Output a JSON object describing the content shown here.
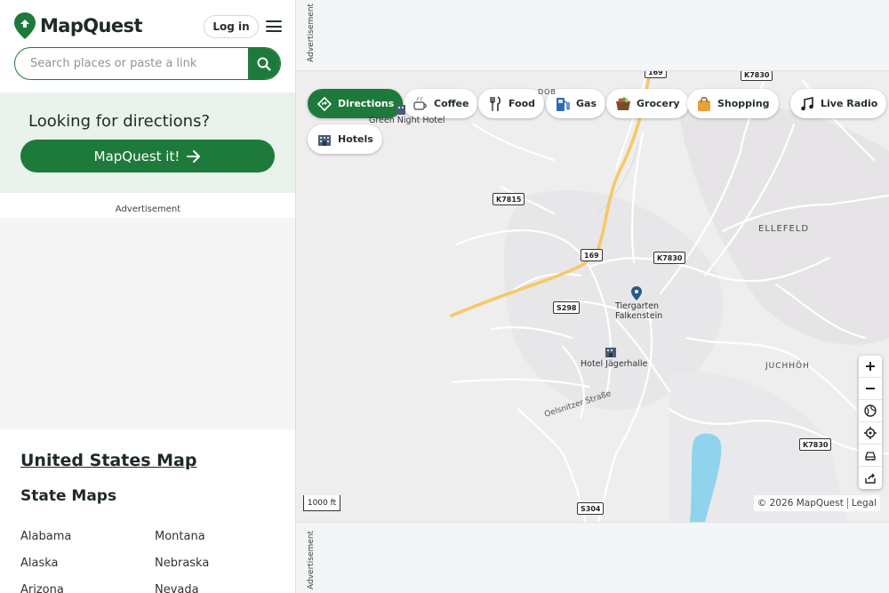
{
  "header": {
    "logo_text": "MapQuest",
    "login_label": "Log in",
    "search": {
      "placeholder": "Search places or paste a link",
      "value": ""
    }
  },
  "directions_card": {
    "title": "Looking for directions?",
    "button_label": "MapQuest it!"
  },
  "ad_label": "Advertisement",
  "us_map_link": "United States Map",
  "state_maps": {
    "title": "State Maps",
    "col1": [
      "Alabama",
      "Alaska",
      "Arizona"
    ],
    "col2": [
      "Montana",
      "Nebraska",
      "Nevada"
    ]
  },
  "map": {
    "chips": [
      {
        "label": "Directions",
        "icon": "directions-icon",
        "active": true
      },
      {
        "label": "Coffee",
        "icon": "coffee-icon"
      },
      {
        "label": "Food",
        "icon": "food-icon"
      },
      {
        "label": "Gas",
        "icon": "gas-icon"
      },
      {
        "label": "Grocery",
        "icon": "grocery-icon"
      },
      {
        "label": "Shopping",
        "icon": "shopping-icon"
      },
      {
        "label": "Live Radio",
        "icon": "radio-icon"
      },
      {
        "label": "Hotels",
        "icon": "hotel-icon"
      }
    ],
    "labels": {
      "green_night_hotel": "Green Night Hotel",
      "tiergarten_line1": "Tiergarten",
      "tiergarten_line2": "Falkenstein",
      "hotel_jagerhalle": "Hotel Jägerhalle",
      "ellefeld": "ELLEFELD",
      "juchhoh": "JUCHHÖH",
      "dob": "DOB",
      "oelsnitzer": "Oelsnitzer Straße"
    },
    "shields": [
      "169",
      "K7830",
      "K7815",
      "169",
      "K7830",
      "S298",
      "K7830",
      "S304"
    ],
    "scale": "1000 ft",
    "attribution": {
      "copyright": "© 2026 MapQuest",
      "legal": "Legal"
    },
    "controls": [
      "zoom-in",
      "zoom-out",
      "globe",
      "locate",
      "traffic",
      "share"
    ]
  },
  "colors": {
    "brand_green": "#1e7a3a",
    "card_bg": "#e9f3ec",
    "map_bg": "#eeeeee",
    "highway": "#f6c866",
    "water": "#8fd3ec"
  }
}
